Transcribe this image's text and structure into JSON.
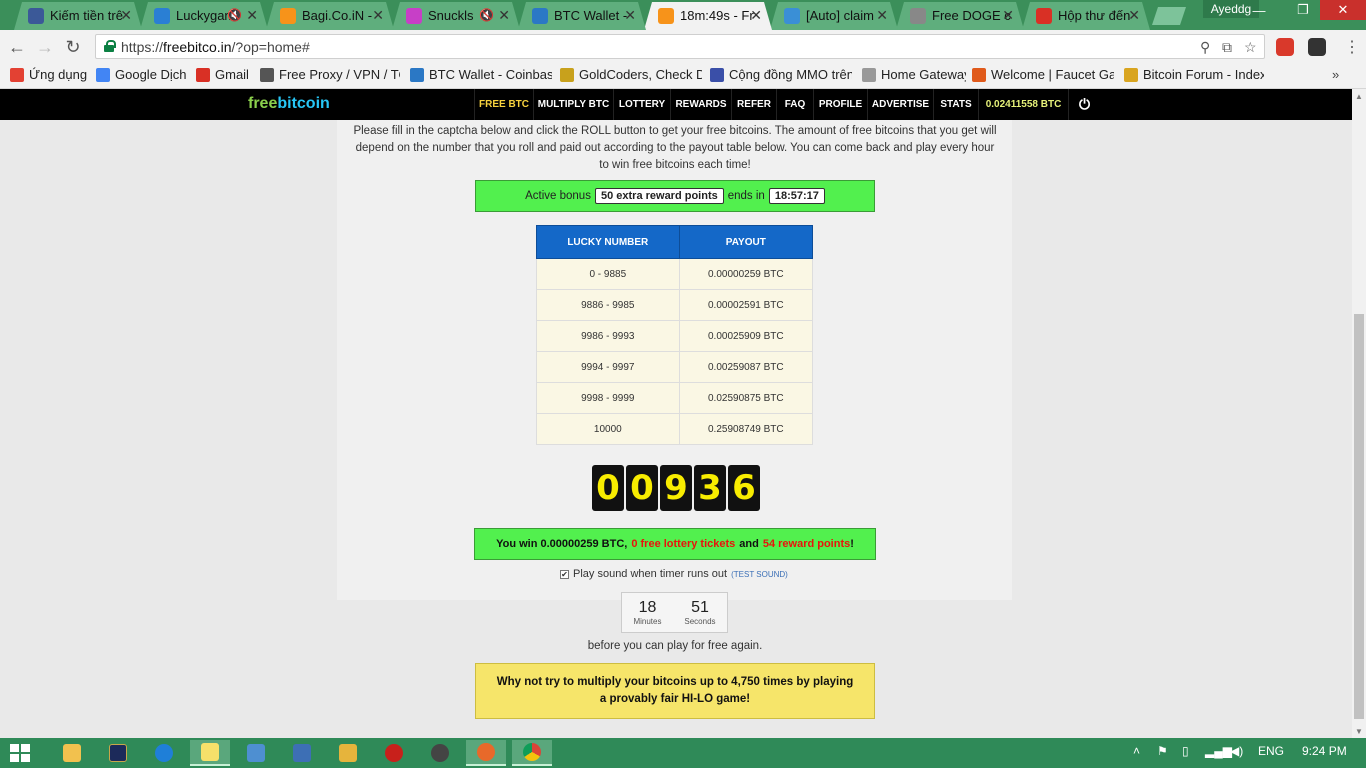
{
  "browser": {
    "tabs": [
      {
        "title": "Kiếm tiền trê",
        "favicon": "facebook-icon",
        "color": "#3b5998",
        "muted": false,
        "active": false
      },
      {
        "title": "Luckygam",
        "favicon": "star-icon",
        "color": "#2a7fd4",
        "muted": true,
        "active": false
      },
      {
        "title": "Bagi.Co.iN -",
        "favicon": "bitcoin-icon",
        "color": "#f7931a",
        "muted": false,
        "active": false
      },
      {
        "title": "Snuckls",
        "favicon": "s-logo-icon",
        "color": "#c73fc7",
        "muted": true,
        "active": false
      },
      {
        "title": "BTC Wallet -",
        "favicon": "coinbase-icon",
        "color": "#2b78c5",
        "muted": false,
        "active": false
      },
      {
        "title": "18m:49s - Fr",
        "favicon": "bitcoin-icon",
        "color": "#f7931a",
        "muted": false,
        "active": true
      },
      {
        "title": "[Auto] claim",
        "favicon": "s-circle-icon",
        "color": "#3a8fd6",
        "muted": false,
        "active": false
      },
      {
        "title": "Free DOGE c",
        "favicon": "doge-icon",
        "color": "#888888",
        "muted": false,
        "active": false
      },
      {
        "title": "Hộp thư đến",
        "favicon": "gmail-icon",
        "color": "#d93025",
        "muted": false,
        "active": false
      }
    ],
    "profile_name": "Ayeddg",
    "url_prefix": "https://",
    "url_host": "freebitco.in",
    "url_path": "/?op=home#"
  },
  "bookmarks": [
    {
      "label": "Ứng dụng",
      "icon": "apps-grid-icon",
      "color": "#e34133"
    },
    {
      "label": "Google Dịch",
      "icon": "google-translate-icon",
      "color": "#4285f4"
    },
    {
      "label": "Gmail",
      "icon": "gmail-icon",
      "color": "#d93025"
    },
    {
      "label": "Free Proxy / VPN / TO",
      "icon": "proxy-icon",
      "color": "#555555"
    },
    {
      "label": "BTC Wallet - Coinbase",
      "icon": "coinbase-icon",
      "color": "#2b78c5"
    },
    {
      "label": "GoldCoders, Check Do",
      "icon": "goldcoders-icon",
      "color": "#c8a11c"
    },
    {
      "label": "Cộng đồng MMO trên",
      "icon": "shield-icon",
      "color": "#3a4fa8"
    },
    {
      "label": "Home Gateway",
      "icon": "page-icon",
      "color": "#999999"
    },
    {
      "label": "Welcome | Faucet Gar",
      "icon": "faucet-icon",
      "color": "#e05a1b"
    },
    {
      "label": "Bitcoin Forum - Index",
      "icon": "bitcoin-icon",
      "color": "#d9a520"
    }
  ],
  "site": {
    "logo_part1": "free",
    "logo_part2": "bitcoin",
    "nav": [
      "FREE BTC",
      "MULTIPLY BTC",
      "LOTTERY",
      "REWARDS",
      "REFER",
      "FAQ",
      "PROFILE",
      "ADVERTISE",
      "STATS"
    ],
    "balance": "0.02411558 BTC",
    "intro": "Please fill in the captcha below and click the ROLL button to get your free bitcoins. The amount of free bitcoins that you get will depend on the number that you roll and paid out according to the payout table below. You can come back and play every hour to win free bitcoins each time!",
    "bonus": {
      "prefix": "Active bonus",
      "reward": "50 extra reward points",
      "middle": "ends in",
      "time": "18:57:17"
    },
    "payout_table": {
      "headers": [
        "LUCKY NUMBER",
        "PAYOUT"
      ],
      "rows": [
        [
          "0 - 9885",
          "0.00000259 BTC"
        ],
        [
          "9886 - 9985",
          "0.00002591 BTC"
        ],
        [
          "9986 - 9993",
          "0.00025909 BTC"
        ],
        [
          "9994 - 9997",
          "0.00259087 BTC"
        ],
        [
          "9998 - 9999",
          "0.02590875 BTC"
        ],
        [
          "10000",
          "0.25908749 BTC"
        ]
      ]
    },
    "roll_digits": [
      "0",
      "0",
      "9",
      "3",
      "6"
    ],
    "win": {
      "part1": "You win 0.00000259 BTC,",
      "tickets": "0 free lottery tickets",
      "and": "and",
      "points": "54 reward points",
      "end": "!"
    },
    "sound_label": "Play sound when timer runs out",
    "test_sound": "(TEST SOUND)",
    "timer": {
      "minutes": "18",
      "minutes_label": "Minutes",
      "seconds": "51",
      "seconds_label": "Seconds"
    },
    "before_text": "before you can play for free again.",
    "promo_text": "Why not try to multiply your bitcoins up to 4,750 times by playing a provably fair HI-LO game!"
  },
  "taskbar": {
    "language": "ENG",
    "time": "9:24 PM"
  }
}
